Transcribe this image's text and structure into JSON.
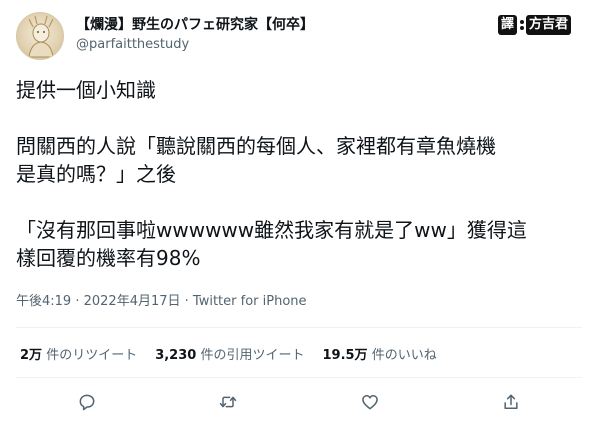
{
  "user": {
    "display_name": "【爛漫】野生のパフェ研究家【何卒】",
    "handle": "@parfaitthestudy"
  },
  "translator_badge": {
    "left_label": "譯",
    "right_label": "方吉君"
  },
  "tweet": {
    "paragraphs": [
      "提供一個小知識",
      "問關西的人說「聽說關西的每個人、家裡都有章魚燒機\n是真的嗎？」之後",
      "「沒有那回事啦wwwwww雖然我家有就是了ww」獲得這\n樣回覆的機率有98%"
    ]
  },
  "meta": {
    "time": "午後4:19",
    "separator": " · ",
    "date": "2022年4月17日",
    "source": "Twitter for iPhone"
  },
  "stats": {
    "retweets_count": "2万",
    "retweets_label": "件のリツイート",
    "quotes_count": "3,230",
    "quotes_label": "件の引用ツイート",
    "likes_count": "19.5万",
    "likes_label": "件のいいね"
  },
  "actions": [
    "reply-icon",
    "retweet-icon",
    "like-icon",
    "share-icon"
  ],
  "colors": {
    "text": "#0f1419",
    "secondary": "#536471",
    "divider": "#eff3f4"
  }
}
